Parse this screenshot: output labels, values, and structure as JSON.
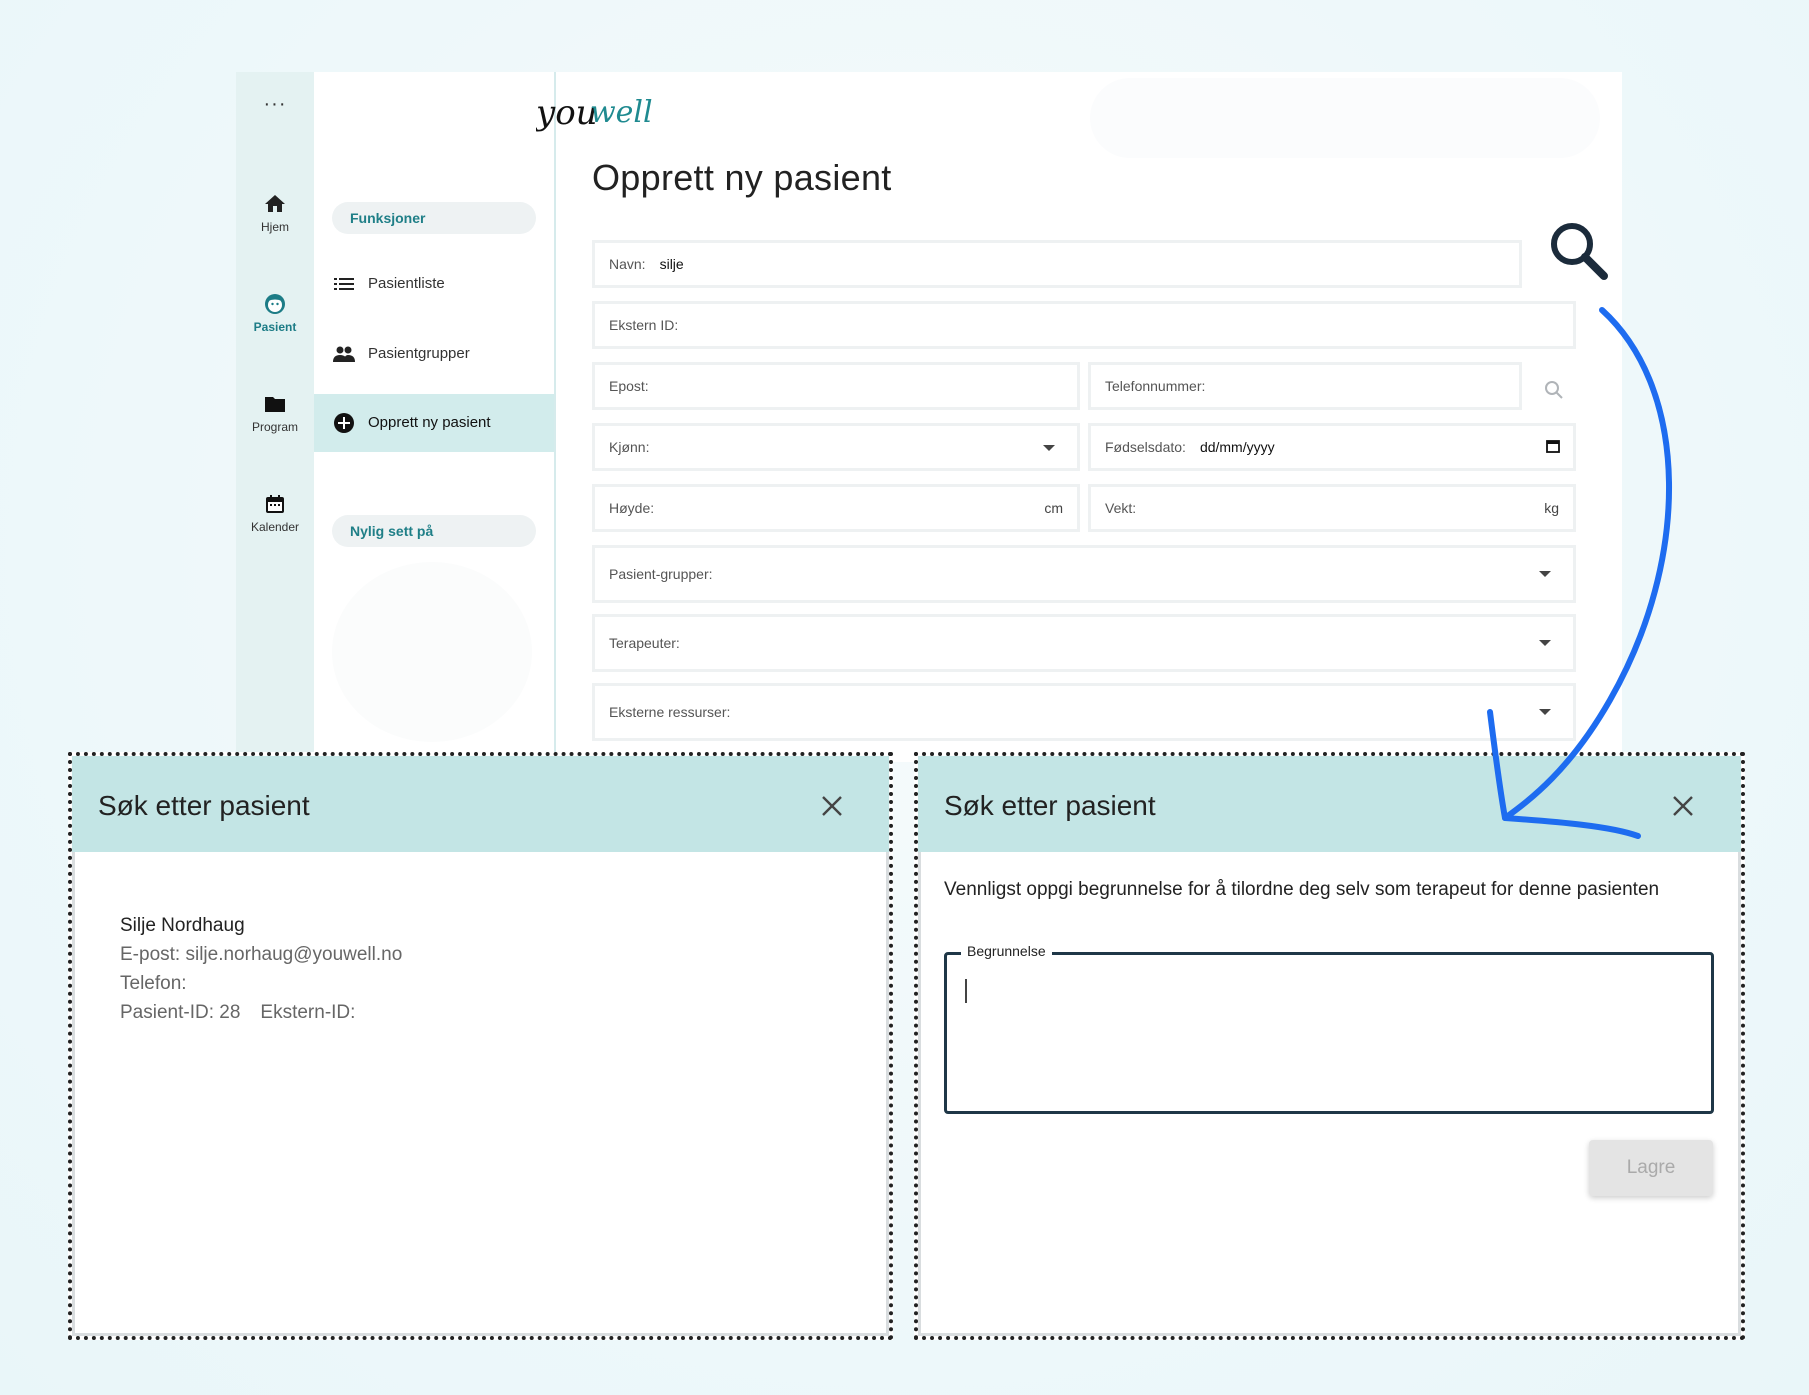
{
  "brand": {
    "logo_text": "youwell",
    "accent": "#1f7f87",
    "arrow_color": "#1e6cf0"
  },
  "rail": {
    "menu_glyph": "···",
    "items": [
      {
        "label": "Hjem",
        "icon": "home-icon"
      },
      {
        "label": "Pasient",
        "icon": "patient-face-icon"
      },
      {
        "label": "Program",
        "icon": "folder-icon"
      },
      {
        "label": "Kalender",
        "icon": "calendar-icon"
      }
    ]
  },
  "subnav": {
    "section_functions": "Funksjoner",
    "items": [
      {
        "label": "Pasientliste",
        "icon": "list-icon"
      },
      {
        "label": "Pasientgrupper",
        "icon": "people-icon"
      },
      {
        "label": "Opprett ny pasient",
        "icon": "add-circle-icon"
      }
    ],
    "section_recent": "Nylig sett på"
  },
  "form": {
    "title": "Opprett ny pasient",
    "name_label": "Navn:",
    "name_value": "silje",
    "external_id_label": "Ekstern ID:",
    "email_label": "Epost:",
    "phone_label": "Telefonnummer:",
    "gender_label": "Kjønn:",
    "dob_label": "Fødselsdato:",
    "dob_value": "dd/mm/yyyy",
    "height_label": "Høyde:",
    "height_unit": "cm",
    "weight_label": "Vekt:",
    "weight_unit": "kg",
    "groups_label": "Pasient-grupper:",
    "therapists_label": "Terapeuter:",
    "resources_label": "Eksterne ressurser:"
  },
  "search_dialog": {
    "title": "Søk etter pasient",
    "result": {
      "name": "Silje Nordhaug",
      "email_line": "E-post: silje.norhaug@youwell.no",
      "phone_line": "Telefon:",
      "patient_id_line": "Pasient-ID: 28",
      "external_id_line": "Ekstern-ID:"
    }
  },
  "reason_dialog": {
    "title": "Søk etter pasient",
    "instruction": "Vennligst oppgi begrunnelse for å tilordne deg selv som terapeut for denne pasienten",
    "field_label": "Begrunnelse",
    "field_value": "",
    "save_label": "Lagre"
  }
}
